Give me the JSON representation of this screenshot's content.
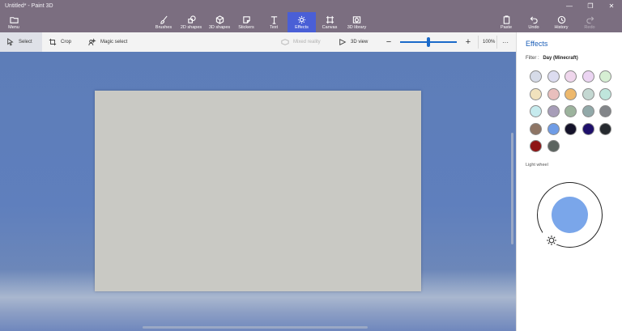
{
  "window": {
    "title": "Untitled* - Paint 3D",
    "minimize_glyph": "—",
    "maximize_glyph": "❐",
    "close_glyph": "✕"
  },
  "ribbon": {
    "menu": "Menu",
    "brushes": "Brushes",
    "shapes2d": "2D shapes",
    "shapes3d": "3D shapes",
    "stickers": "Stickers",
    "text": "Text",
    "effects": "Effects",
    "canvas": "Canvas",
    "library3d": "3D library",
    "paste": "Paste",
    "undo": "Undo",
    "history": "History",
    "redo": "Redo"
  },
  "toolbar": {
    "select": "Select",
    "crop": "Crop",
    "magic_select": "Magic select",
    "mixed_reality": "Mixed reality",
    "view3d": "3D view",
    "zoom_minus": "−",
    "zoom_plus": "+",
    "zoom_level": "100%",
    "more": "···"
  },
  "panel": {
    "title": "Effects",
    "filter_label": "Filter :",
    "filter_value": "Day (Minecraft)",
    "light_wheel_label": "Light wheel",
    "filters": [
      {
        "color": "#d6dbe8",
        "name": "filter-1"
      },
      {
        "color": "#dcdcf0",
        "name": "filter-2"
      },
      {
        "color": "#efd6ec",
        "name": "filter-3"
      },
      {
        "color": "#ebd4f2",
        "name": "filter-4"
      },
      {
        "color": "#d6efd3",
        "name": "filter-5"
      },
      {
        "color": "#f1e2bd",
        "name": "filter-6"
      },
      {
        "color": "#e9bfbd",
        "name": "filter-7"
      },
      {
        "color": "#edb86c",
        "name": "filter-8"
      },
      {
        "color": "#c4d8d2",
        "name": "filter-9"
      },
      {
        "color": "#bfe6dc",
        "name": "filter-10"
      },
      {
        "color": "#c6ebee",
        "name": "filter-11"
      },
      {
        "color": "#a79db8",
        "name": "filter-12"
      },
      {
        "color": "#9cb39d",
        "name": "filter-13"
      },
      {
        "color": "#92a9a9",
        "name": "filter-14"
      },
      {
        "color": "#828589",
        "name": "filter-15"
      },
      {
        "color": "#8e7565",
        "name": "filter-16"
      },
      {
        "color": "#6f9ce6",
        "name": "filter-17"
      },
      {
        "color": "#14122a",
        "name": "filter-18"
      },
      {
        "color": "#1e0f6a",
        "name": "filter-19"
      },
      {
        "color": "#262a2f",
        "name": "filter-20"
      },
      {
        "color": "#8e1414",
        "name": "filter-21"
      },
      {
        "color": "#5c6460",
        "name": "filter-22"
      }
    ]
  },
  "colors": {
    "ribbon": "#7b6e80",
    "active_tab": "#4a5fd6",
    "workspace": "#5f7fbd",
    "canvas": "#c9c9c4",
    "panel_title": "#1c5fb8",
    "light_core": "#7aa6ea"
  }
}
